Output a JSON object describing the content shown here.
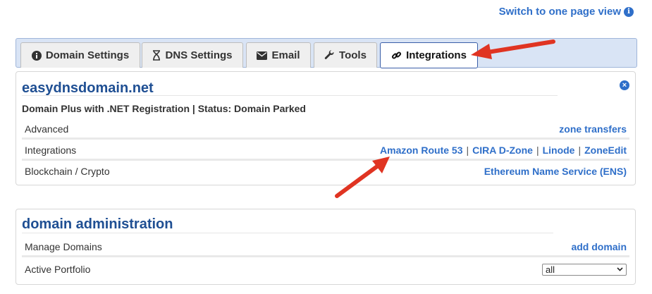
{
  "header": {
    "switch_view_label": "Switch to one page view",
    "switch_view_icon": "info-circle-icon"
  },
  "tabs": [
    {
      "label": "Domain Settings",
      "icon": "info-circle-icon",
      "active": false
    },
    {
      "label": "DNS Settings",
      "icon": "hourglass-icon",
      "active": false
    },
    {
      "label": "Email",
      "icon": "envelope-icon",
      "active": false
    },
    {
      "label": "Tools",
      "icon": "wrench-icon",
      "active": false
    },
    {
      "label": "Integrations",
      "icon": "link-icon",
      "active": true
    }
  ],
  "domain_card": {
    "title": "easydnsdomain.net",
    "subtitle": "Domain Plus with .NET Registration | Status: Domain Parked",
    "close_icon": "close-circle-icon",
    "rows": [
      {
        "label": "Advanced",
        "links": [
          "zone transfers"
        ]
      },
      {
        "label": "Integrations",
        "links": [
          "Amazon Route 53",
          "CIRA D-Zone",
          "Linode",
          "ZoneEdit"
        ]
      },
      {
        "label": "Blockchain / Crypto",
        "links": [
          "Ethereum Name Service (ENS)"
        ]
      }
    ]
  },
  "admin_card": {
    "title": "domain administration",
    "rows": [
      {
        "label": "Manage Domains",
        "link": "add domain"
      },
      {
        "label": "Active Portfolio",
        "select_value": "all"
      }
    ]
  },
  "separator": "|",
  "colors": {
    "link": "#2f6fc9",
    "title": "#1f4f93",
    "tabbar_bg": "#d9e4f5",
    "arrow": "#e03422"
  }
}
